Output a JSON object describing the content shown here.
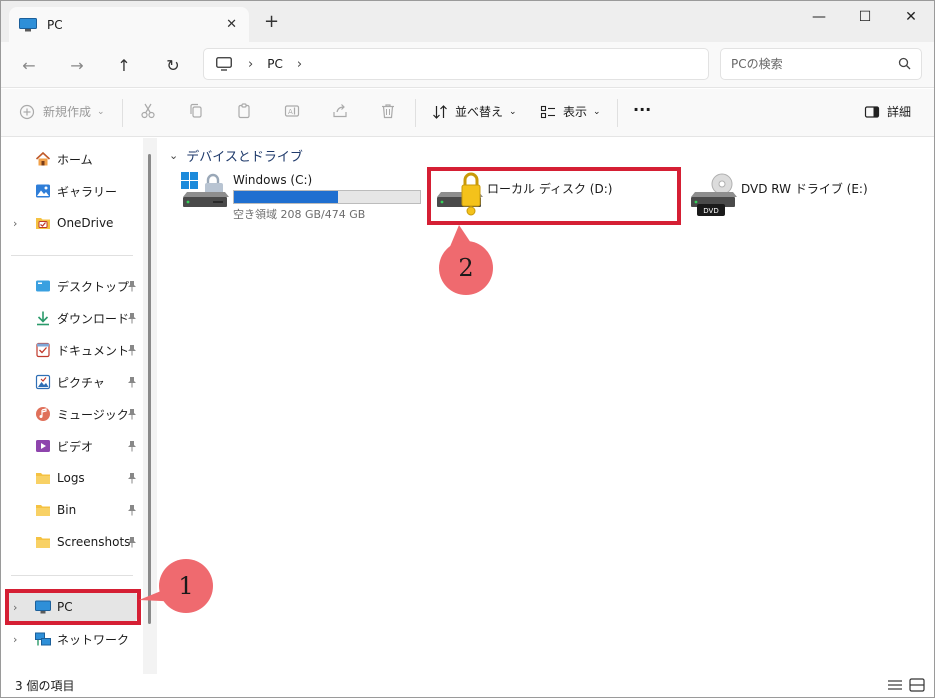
{
  "window": {
    "tab_title": "PC",
    "tab_close": "✕",
    "new_tab": "+",
    "controls": {
      "minimize": "—",
      "maximize": "☐",
      "close": "✕"
    }
  },
  "nav": {
    "back": "←",
    "forward": "→",
    "up": "↑",
    "refresh": "↻",
    "breadcrumb": [
      "PC"
    ],
    "chevron": "›",
    "search_placeholder": "PCの検索"
  },
  "commands": {
    "new_label": "新規作成",
    "sort_label": "並べ替え",
    "view_label": "表示",
    "more_label": "···",
    "details_label": "詳細",
    "caret": "⌄"
  },
  "sidebar": {
    "expander": "›",
    "top": [
      {
        "label": "ホーム",
        "icon": "home-icon"
      },
      {
        "label": "ギャラリー",
        "icon": "gallery-icon"
      },
      {
        "label": "OneDrive",
        "icon": "onedrive-folder-icon",
        "expandable": true
      }
    ],
    "quick": [
      {
        "label": "デスクトップ",
        "icon": "desktop-icon"
      },
      {
        "label": "ダウンロード",
        "icon": "download-icon"
      },
      {
        "label": "ドキュメント",
        "icon": "documents-icon"
      },
      {
        "label": "ピクチャ",
        "icon": "pictures-icon"
      },
      {
        "label": "ミュージック",
        "icon": "music-icon"
      },
      {
        "label": "ビデオ",
        "icon": "videos-icon"
      },
      {
        "label": "Logs",
        "icon": "folder-icon"
      },
      {
        "label": "Bin",
        "icon": "folder-icon"
      },
      {
        "label": "Screenshots",
        "icon": "folder-icon"
      }
    ],
    "bottom": [
      {
        "label": "PC",
        "icon": "pc-icon",
        "selected": true
      },
      {
        "label": "ネットワーク",
        "icon": "network-icon"
      }
    ]
  },
  "main": {
    "group_title": "デバイスとドライブ",
    "group_chevron": "⌄",
    "drives": [
      {
        "name": "Windows (C:)",
        "space_text": "空き領域 208 GB/474 GB",
        "used_fraction": 0.561
      },
      {
        "name": "ローカル ディスク (D:)"
      },
      {
        "name": "DVD RW ドライブ (E:)",
        "icon_label": "DVD"
      }
    ]
  },
  "annotations": {
    "badge_1": "1",
    "badge_2": "2"
  },
  "status": {
    "item_count": "3 個の項目"
  },
  "colors": {
    "accent": "#1f6fd0",
    "highlight": "#d51f34",
    "badge": "#ef6a6f"
  }
}
